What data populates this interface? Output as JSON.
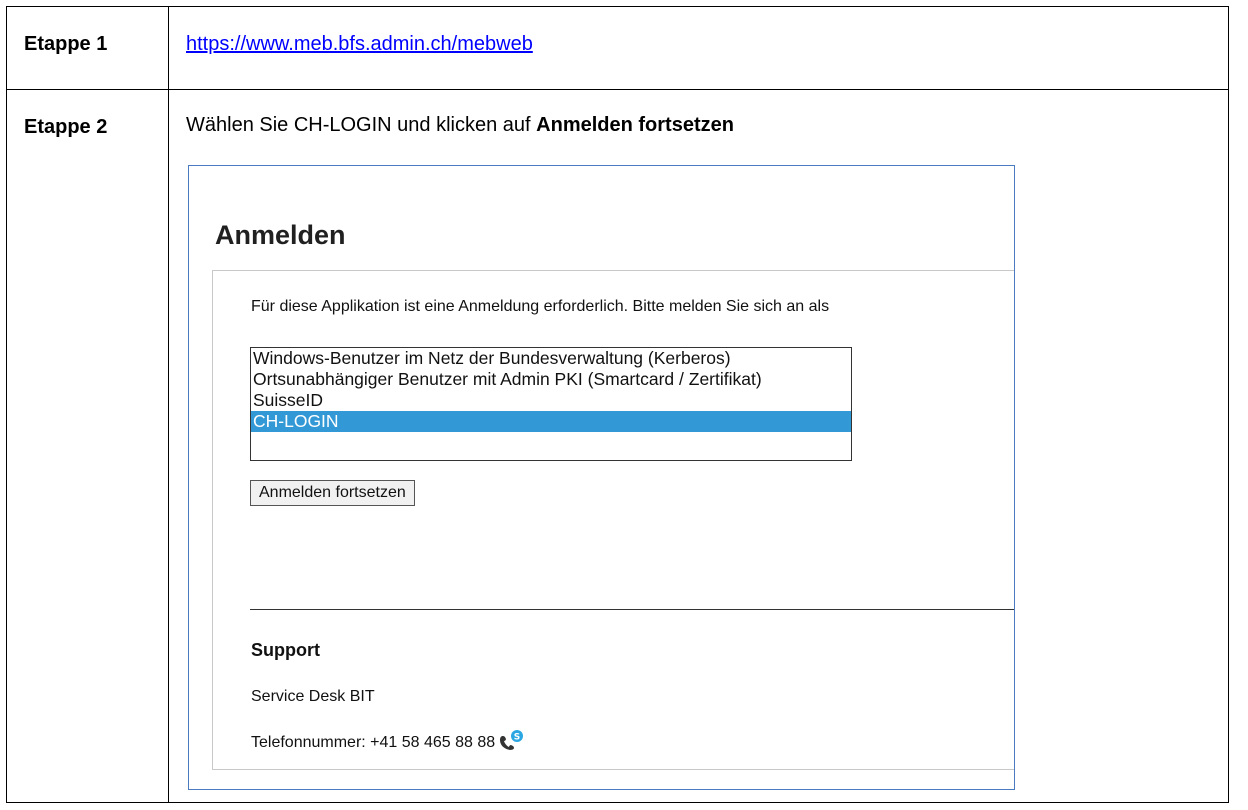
{
  "steps": [
    {
      "label": "Etappe 1",
      "link_text": "https://www.meb.bfs.admin.ch/mebweb"
    },
    {
      "label": "Etappe 2",
      "instruction_prefix": "Wählen Sie CH-LOGIN und klicken auf ",
      "instruction_bold": "Anmelden fortsetzen"
    }
  ],
  "login_screen": {
    "title": "Anmelden",
    "intro": "Für diese Applikation ist eine Anmeldung erforderlich. Bitte melden Sie sich an als",
    "options": [
      "Windows-Benutzer im Netz der Bundesverwaltung (Kerberos)",
      "Ortsunabhängiger Benutzer mit Admin PKI (Smartcard / Zertifikat)",
      "SuisseID",
      "CH-LOGIN"
    ],
    "selected_option": "CH-LOGIN",
    "continue_button": "Anmelden fortsetzen",
    "support": {
      "heading": "Support",
      "name": "Service Desk BIT",
      "phone": "Telefonnummer: +41 58 465 88 88"
    },
    "icons": {
      "phone": "skype-phone-icon"
    },
    "colors": {
      "selection": "#3399d6",
      "frame_border": "#4a7bbf",
      "link": "#0000ff"
    }
  }
}
